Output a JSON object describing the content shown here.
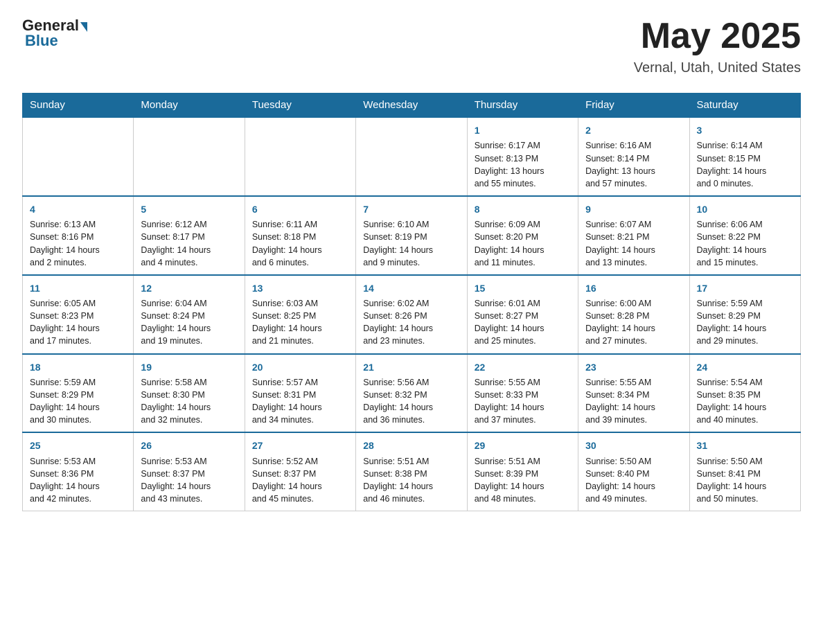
{
  "header": {
    "logo_general": "General",
    "logo_blue": "Blue",
    "month": "May 2025",
    "location": "Vernal, Utah, United States"
  },
  "weekdays": [
    "Sunday",
    "Monday",
    "Tuesday",
    "Wednesday",
    "Thursday",
    "Friday",
    "Saturday"
  ],
  "weeks": [
    [
      {
        "day": "",
        "info": ""
      },
      {
        "day": "",
        "info": ""
      },
      {
        "day": "",
        "info": ""
      },
      {
        "day": "",
        "info": ""
      },
      {
        "day": "1",
        "info": "Sunrise: 6:17 AM\nSunset: 8:13 PM\nDaylight: 13 hours\nand 55 minutes."
      },
      {
        "day": "2",
        "info": "Sunrise: 6:16 AM\nSunset: 8:14 PM\nDaylight: 13 hours\nand 57 minutes."
      },
      {
        "day": "3",
        "info": "Sunrise: 6:14 AM\nSunset: 8:15 PM\nDaylight: 14 hours\nand 0 minutes."
      }
    ],
    [
      {
        "day": "4",
        "info": "Sunrise: 6:13 AM\nSunset: 8:16 PM\nDaylight: 14 hours\nand 2 minutes."
      },
      {
        "day": "5",
        "info": "Sunrise: 6:12 AM\nSunset: 8:17 PM\nDaylight: 14 hours\nand 4 minutes."
      },
      {
        "day": "6",
        "info": "Sunrise: 6:11 AM\nSunset: 8:18 PM\nDaylight: 14 hours\nand 6 minutes."
      },
      {
        "day": "7",
        "info": "Sunrise: 6:10 AM\nSunset: 8:19 PM\nDaylight: 14 hours\nand 9 minutes."
      },
      {
        "day": "8",
        "info": "Sunrise: 6:09 AM\nSunset: 8:20 PM\nDaylight: 14 hours\nand 11 minutes."
      },
      {
        "day": "9",
        "info": "Sunrise: 6:07 AM\nSunset: 8:21 PM\nDaylight: 14 hours\nand 13 minutes."
      },
      {
        "day": "10",
        "info": "Sunrise: 6:06 AM\nSunset: 8:22 PM\nDaylight: 14 hours\nand 15 minutes."
      }
    ],
    [
      {
        "day": "11",
        "info": "Sunrise: 6:05 AM\nSunset: 8:23 PM\nDaylight: 14 hours\nand 17 minutes."
      },
      {
        "day": "12",
        "info": "Sunrise: 6:04 AM\nSunset: 8:24 PM\nDaylight: 14 hours\nand 19 minutes."
      },
      {
        "day": "13",
        "info": "Sunrise: 6:03 AM\nSunset: 8:25 PM\nDaylight: 14 hours\nand 21 minutes."
      },
      {
        "day": "14",
        "info": "Sunrise: 6:02 AM\nSunset: 8:26 PM\nDaylight: 14 hours\nand 23 minutes."
      },
      {
        "day": "15",
        "info": "Sunrise: 6:01 AM\nSunset: 8:27 PM\nDaylight: 14 hours\nand 25 minutes."
      },
      {
        "day": "16",
        "info": "Sunrise: 6:00 AM\nSunset: 8:28 PM\nDaylight: 14 hours\nand 27 minutes."
      },
      {
        "day": "17",
        "info": "Sunrise: 5:59 AM\nSunset: 8:29 PM\nDaylight: 14 hours\nand 29 minutes."
      }
    ],
    [
      {
        "day": "18",
        "info": "Sunrise: 5:59 AM\nSunset: 8:29 PM\nDaylight: 14 hours\nand 30 minutes."
      },
      {
        "day": "19",
        "info": "Sunrise: 5:58 AM\nSunset: 8:30 PM\nDaylight: 14 hours\nand 32 minutes."
      },
      {
        "day": "20",
        "info": "Sunrise: 5:57 AM\nSunset: 8:31 PM\nDaylight: 14 hours\nand 34 minutes."
      },
      {
        "day": "21",
        "info": "Sunrise: 5:56 AM\nSunset: 8:32 PM\nDaylight: 14 hours\nand 36 minutes."
      },
      {
        "day": "22",
        "info": "Sunrise: 5:55 AM\nSunset: 8:33 PM\nDaylight: 14 hours\nand 37 minutes."
      },
      {
        "day": "23",
        "info": "Sunrise: 5:55 AM\nSunset: 8:34 PM\nDaylight: 14 hours\nand 39 minutes."
      },
      {
        "day": "24",
        "info": "Sunrise: 5:54 AM\nSunset: 8:35 PM\nDaylight: 14 hours\nand 40 minutes."
      }
    ],
    [
      {
        "day": "25",
        "info": "Sunrise: 5:53 AM\nSunset: 8:36 PM\nDaylight: 14 hours\nand 42 minutes."
      },
      {
        "day": "26",
        "info": "Sunrise: 5:53 AM\nSunset: 8:37 PM\nDaylight: 14 hours\nand 43 minutes."
      },
      {
        "day": "27",
        "info": "Sunrise: 5:52 AM\nSunset: 8:37 PM\nDaylight: 14 hours\nand 45 minutes."
      },
      {
        "day": "28",
        "info": "Sunrise: 5:51 AM\nSunset: 8:38 PM\nDaylight: 14 hours\nand 46 minutes."
      },
      {
        "day": "29",
        "info": "Sunrise: 5:51 AM\nSunset: 8:39 PM\nDaylight: 14 hours\nand 48 minutes."
      },
      {
        "day": "30",
        "info": "Sunrise: 5:50 AM\nSunset: 8:40 PM\nDaylight: 14 hours\nand 49 minutes."
      },
      {
        "day": "31",
        "info": "Sunrise: 5:50 AM\nSunset: 8:41 PM\nDaylight: 14 hours\nand 50 minutes."
      }
    ]
  ]
}
